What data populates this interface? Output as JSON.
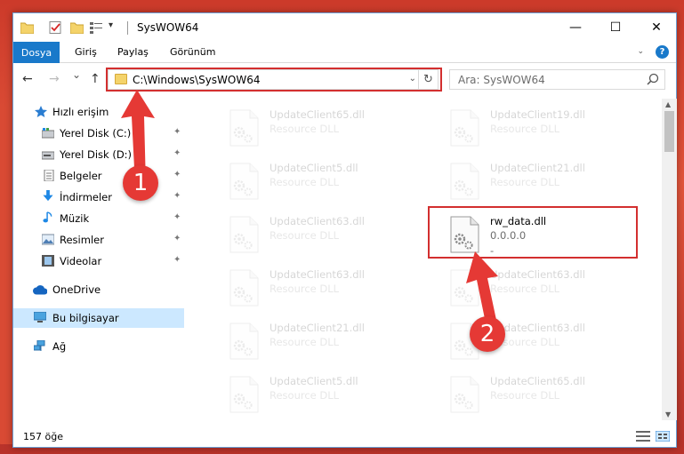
{
  "titlebar": {
    "title": "SysWOW64",
    "minimize_glyph": "—",
    "maximize_glyph": "☐",
    "close_glyph": "✕"
  },
  "ribbon": {
    "tabs": [
      "Dosya",
      "Giriş",
      "Paylaş",
      "Görünüm"
    ],
    "help_glyph": "?"
  },
  "nav": {
    "back_glyph": "←",
    "forward_glyph": "→",
    "recent_glyph": "⌄",
    "up_glyph": "↑",
    "address": "C:\\Windows\\SysWOW64",
    "search_placeholder": "Ara: SysWOW64"
  },
  "sidebar": {
    "items": [
      {
        "label": "Hızlı erişim",
        "icon": "star-icon",
        "pinned": false
      },
      {
        "label": "Yerel Disk (C:)",
        "icon": "drive-icon",
        "pinned": true
      },
      {
        "label": "Yerel Disk (D:)",
        "icon": "drive-icon",
        "pinned": true
      },
      {
        "label": "Belgeler",
        "icon": "document-icon",
        "pinned": true
      },
      {
        "label": "İndirmeler",
        "icon": "download-icon",
        "pinned": true
      },
      {
        "label": "Müzik",
        "icon": "music-icon",
        "pinned": true
      },
      {
        "label": "Resimler",
        "icon": "pictures-icon",
        "pinned": true
      },
      {
        "label": "Videolar",
        "icon": "video-icon",
        "pinned": true
      },
      {
        "label": "OneDrive",
        "icon": "cloud-icon",
        "pinned": false
      },
      {
        "label": "Bu bilgisayar",
        "icon": "computer-icon",
        "pinned": false
      },
      {
        "label": "Ağ",
        "icon": "network-icon",
        "pinned": false
      }
    ],
    "pin_glyph": "📌"
  },
  "files": [
    {
      "name": "UpdateClient65.dll",
      "desc": "Resource DLL"
    },
    {
      "name": "UpdateClient19.dll",
      "desc": "Resource DLL"
    },
    {
      "name": "UpdateClient5.dll",
      "desc": "Resource DLL"
    },
    {
      "name": "UpdateClient21.dll",
      "desc": "Resource DLL"
    },
    {
      "name": "UpdateClient63.dll",
      "desc": "Resource DLL"
    },
    {
      "name": "rw_data.dll",
      "desc": "0.0.0.0",
      "extra": "-"
    },
    {
      "name": "UpdateClient63.dll",
      "desc": "Resource DLL"
    },
    {
      "name": "UpdateClient63.dll",
      "desc": "Resource DLL"
    },
    {
      "name": "UpdateClient21.dll",
      "desc": "Resource DLL"
    },
    {
      "name": "UpdateClient63.dll",
      "desc": "Resource DLL"
    },
    {
      "name": "UpdateClient5.dll",
      "desc": "Resource DLL"
    },
    {
      "name": "UpdateClient65.dll",
      "desc": "Resource DLL"
    }
  ],
  "status": {
    "item_count": "157 öğe"
  },
  "annotations": {
    "step1": "1",
    "step2": "2",
    "color": "#e53935"
  },
  "colors": {
    "accent": "#1979ca",
    "highlight_box": "#d32f2f",
    "selected_nav": "#cce8ff"
  }
}
